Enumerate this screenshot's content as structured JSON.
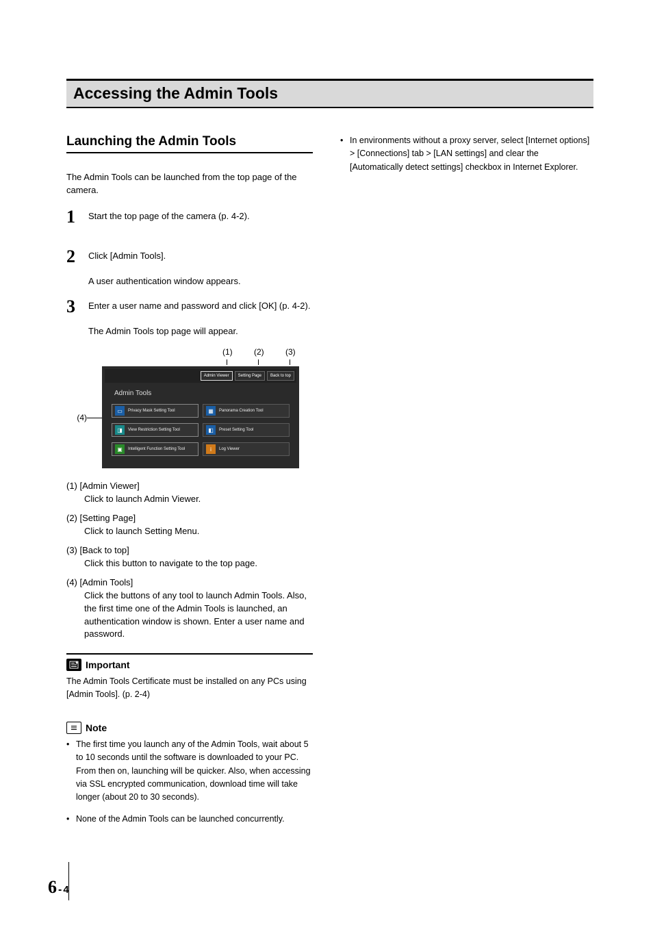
{
  "chapterTitle": "Accessing the Admin Tools",
  "section": {
    "title": "Launching the Admin Tools",
    "intro": "The Admin Tools can be launched from the top page of the camera.",
    "steps": [
      {
        "num": "1",
        "text": "Start the top page of the camera (p. 4-2)."
      },
      {
        "num": "2",
        "text": "Click [Admin Tools].",
        "sub": "A user authentication window appears."
      },
      {
        "num": "3",
        "text": "Enter a user name and password and click [OK] (p. 4-2).",
        "sub": "The Admin Tools top page will appear."
      }
    ]
  },
  "figure": {
    "calloutsTop": [
      "(1)",
      "(2)",
      "(3)"
    ],
    "calloutLeft": "(4)",
    "screenshot": {
      "topButtons": [
        "Admin Viewer",
        "Setting Page",
        "Back to top"
      ],
      "title": "Admin Tools",
      "tools": [
        {
          "label": "Privacy Mask Setting Tool",
          "icon": "privacy-mask-icon",
          "cls": "left"
        },
        {
          "label": "Panorama Creation Tool",
          "icon": "panorama-icon",
          "cls": ""
        },
        {
          "label": "View Restriction Setting Tool",
          "icon": "view-restriction-icon",
          "cls": "left"
        },
        {
          "label": "Preset Setting Tool",
          "icon": "preset-icon",
          "cls": ""
        },
        {
          "label": "Intelligent Function Setting Tool",
          "icon": "intelligent-function-icon",
          "cls": "left"
        },
        {
          "label": "Log Viewer",
          "icon": "log-viewer-icon",
          "cls": ""
        }
      ]
    }
  },
  "definitions": [
    {
      "head": "(1) [Admin Viewer]",
      "body": "Click to launch Admin Viewer."
    },
    {
      "head": "(2) [Setting Page]",
      "body": "Click to launch Setting Menu."
    },
    {
      "head": "(3) [Back to top]",
      "body": "Click this button to navigate to the top page."
    },
    {
      "head": "(4) [Admin Tools]",
      "body": "Click the buttons of any tool to launch Admin Tools. Also, the first time one of the Admin Tools is launched, an authentication window is shown. Enter a user name and password."
    }
  ],
  "important": {
    "label": "Important",
    "text": "The Admin Tools Certificate must be installed on any PCs using [Admin Tools]. (p. 2-4)"
  },
  "note": {
    "label": "Note",
    "items": [
      "The first time you launch any of the Admin Tools, wait about 5 to 10 seconds until the software is downloaded to your PC. From then on, launching will be quicker. Also, when accessing via SSL encrypted communication, download time will take longer (about 20 to 30 seconds).",
      "None of the Admin Tools can be launched concurrently."
    ]
  },
  "rightColumn": {
    "bullet": "In environments without a proxy server, select [Internet options] > [Connections] tab > [LAN settings] and clear the [Automatically detect settings] checkbox in Internet Explorer."
  },
  "footer": {
    "chapter": "6",
    "dash": "-",
    "page": "4"
  }
}
